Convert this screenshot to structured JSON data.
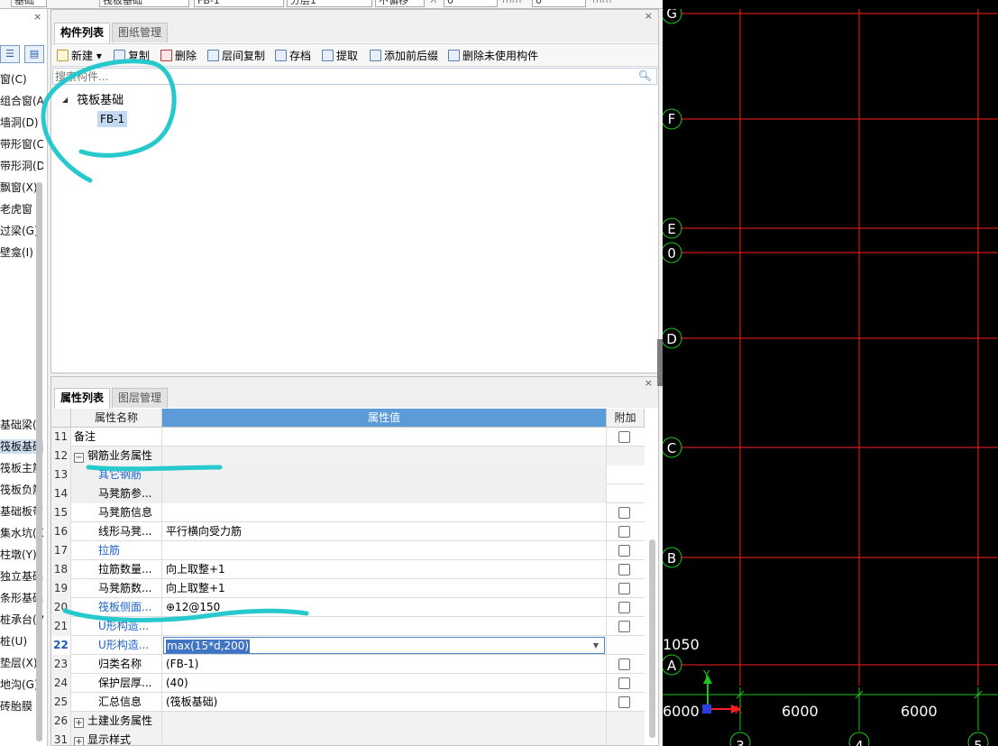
{
  "top_strip": {
    "cells": [
      "基础",
      "筏板基础",
      "FB-1",
      "分层1",
      "不偏移",
      "0",
      "0"
    ],
    "units": [
      "X",
      "mm",
      "mm"
    ]
  },
  "left_panel": {
    "close": "×",
    "view_buttons": [
      "list-view-icon",
      "detail-view-icon"
    ],
    "items_top": [
      "窗(C)",
      "组合窗(A",
      "墙洞(D)",
      "带形窗(C",
      "带形洞(D",
      "飘窗(X)",
      "老虎窗",
      "过梁(G)",
      "壁龛(I)"
    ],
    "items_bottom": [
      "基础梁(F",
      "筏板基础",
      "筏板主筋",
      "筏板负筋",
      "基础板带",
      "集水坑(K",
      "柱墩(Y)",
      "独立基础",
      "条形基础",
      "桩承台(V",
      "桩(U)",
      "垫层(X)",
      "地沟(G)",
      "砖胎膜"
    ],
    "selected_index": 1
  },
  "component_panel": {
    "tabs": [
      "构件列表",
      "图纸管理"
    ],
    "close": "×",
    "toolbar": [
      "新建 ▾",
      "复制",
      "删除",
      "层间复制",
      "存档",
      "提取",
      "添加前后缀",
      "删除未使用构件"
    ],
    "search_placeholder": "搜索构件...",
    "tree_root": "筏板基础",
    "tree_child": "FB-1"
  },
  "property_panel": {
    "tabs": [
      "属性列表",
      "图层管理"
    ],
    "close": "×",
    "headers": {
      "name": "属性名称",
      "value": "属性值",
      "add": "附加"
    },
    "rows": [
      {
        "num": "11",
        "name": "备注",
        "value": "",
        "checkbox": true,
        "style": "plain"
      },
      {
        "num": "12",
        "name": "钢筋业务属性",
        "value": "",
        "checkbox": false,
        "style": "group",
        "expander": "−"
      },
      {
        "num": "13",
        "name": "其它钢筋",
        "value": "",
        "checkbox": false,
        "style": "blue"
      },
      {
        "num": "14",
        "name": "马凳筋参...",
        "value": "",
        "checkbox": false,
        "style": "ind"
      },
      {
        "num": "15",
        "name": "马凳筋信息",
        "value": "",
        "checkbox": true,
        "style": "ind"
      },
      {
        "num": "16",
        "name": "线形马凳...",
        "value": "平行横向受力筋",
        "checkbox": true,
        "style": "ind"
      },
      {
        "num": "17",
        "name": "拉筋",
        "value": "",
        "checkbox": true,
        "style": "blue"
      },
      {
        "num": "18",
        "name": "拉筋数量...",
        "value": "向上取整+1",
        "checkbox": true,
        "style": "ind"
      },
      {
        "num": "19",
        "name": "马凳筋数...",
        "value": "向上取整+1",
        "checkbox": true,
        "style": "ind"
      },
      {
        "num": "20",
        "name": "筏板侧面...",
        "value": "⊕12@150",
        "checkbox": true,
        "style": "blue"
      },
      {
        "num": "21",
        "name": "U形构造...",
        "value": "",
        "checkbox": true,
        "style": "blue"
      },
      {
        "num": "22",
        "name": "U形构造...",
        "value": "max(15*d,200)",
        "checkbox": false,
        "style": "active"
      },
      {
        "num": "23",
        "name": "归类名称",
        "value": "(FB-1)",
        "checkbox": true,
        "style": "ind"
      },
      {
        "num": "24",
        "name": "保护层厚...",
        "value": "(40)",
        "checkbox": true,
        "style": "ind"
      },
      {
        "num": "25",
        "name": "汇总信息",
        "value": "(筏板基础)",
        "checkbox": true,
        "style": "ind"
      },
      {
        "num": "26",
        "name": "土建业务属性",
        "value": "",
        "checkbox": false,
        "style": "group",
        "expander": "+"
      },
      {
        "num": "31",
        "name": "显示样式",
        "value": "",
        "checkbox": false,
        "style": "group",
        "expander": "+"
      }
    ]
  },
  "cad": {
    "grid_color": "#ff1f1f",
    "axis_label_color": "#ffffff",
    "row_axes": [
      "G",
      "F",
      "E",
      "0",
      "D",
      "C",
      "B",
      "A"
    ],
    "col_axes": [
      "3",
      "4",
      "5"
    ],
    "dimensions": [
      "6000",
      "6000",
      "6000",
      "1050"
    ],
    "ucs": {
      "x": "X",
      "y": "Y"
    }
  },
  "annotations": {
    "stroke_color": "#27c9cc"
  }
}
